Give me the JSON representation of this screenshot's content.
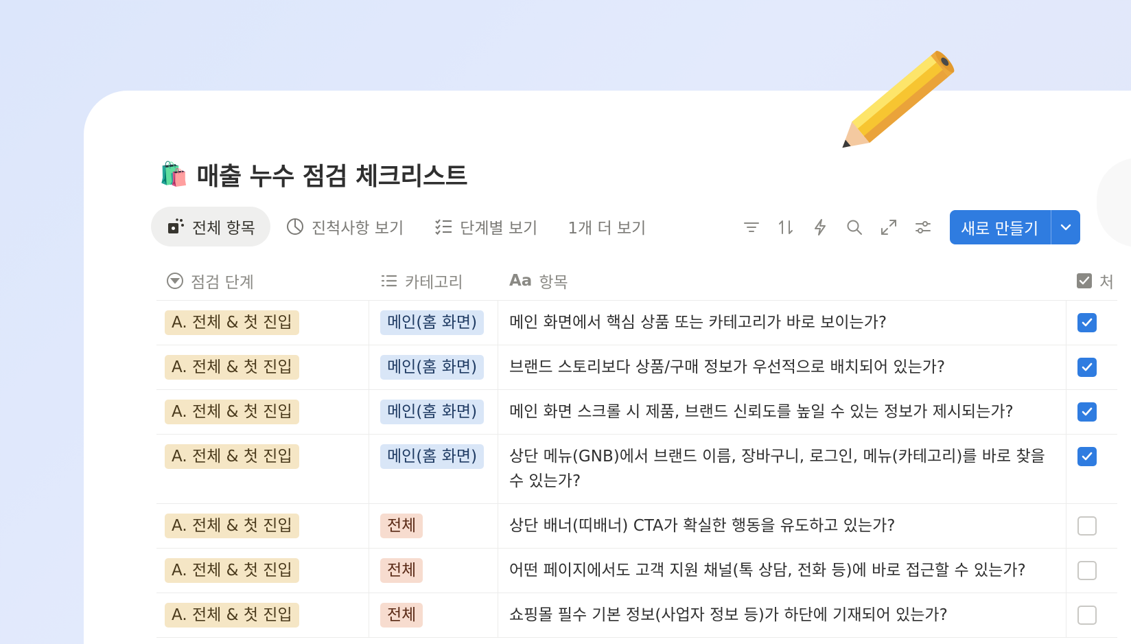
{
  "page": {
    "title": "매출 누수 점검 체크리스트",
    "title_icon": "shopping-bags-icon"
  },
  "views": [
    {
      "label": "전체 항목",
      "icon": "gallery-icon",
      "active": true
    },
    {
      "label": "진척사항 보기",
      "icon": "pie-chart-icon",
      "active": false
    },
    {
      "label": "단계별 보기",
      "icon": "checklist-icon",
      "active": false
    },
    {
      "label": "1개 더 보기",
      "icon": "",
      "active": false
    }
  ],
  "toolbar": {
    "icons": [
      "filter-icon",
      "sort-icon",
      "automation-icon",
      "search-icon",
      "expand-icon",
      "settings-sliders-icon"
    ],
    "new_label": "새로 만들기"
  },
  "columns": {
    "stage": "점검 단계",
    "category": "카테고리",
    "item": "항목",
    "item_icon_text": "Aa",
    "check": "처"
  },
  "rows": [
    {
      "stage": "A. 전체 & 첫 진입",
      "category": "메인(홈 화면)",
      "category_type": "main",
      "item": "메인 화면에서 핵심 상품 또는 카테고리가 바로 보이는가?",
      "checked": true
    },
    {
      "stage": "A. 전체 & 첫 진입",
      "category": "메인(홈 화면)",
      "category_type": "main",
      "item": "브랜드 스토리보다 상품/구매 정보가 우선적으로 배치되어 있는가?",
      "checked": true
    },
    {
      "stage": "A. 전체 & 첫 진입",
      "category": "메인(홈 화면)",
      "category_type": "main",
      "item": "메인 화면 스크롤 시 제품, 브랜드 신뢰도를 높일 수 있는 정보가 제시되는가?",
      "checked": true
    },
    {
      "stage": "A. 전체 & 첫 진입",
      "category": "메인(홈 화면)",
      "category_type": "main",
      "item": "상단 메뉴(GNB)에서 브랜드 이름, 장바구니, 로그인, 메뉴(카테고리)를 바로 찾을 수 있는가?",
      "checked": true
    },
    {
      "stage": "A. 전체 & 첫 진입",
      "category": "전체",
      "category_type": "all",
      "item": "상단 배너(띠배너) CTA가 확실한 행동을 유도하고 있는가?",
      "checked": false
    },
    {
      "stage": "A. 전체 & 첫 진입",
      "category": "전체",
      "category_type": "all",
      "item": "어떤 페이지에서도 고객 지원 채널(톡 상담, 전화 등)에 바로 접근할 수 있는가?",
      "checked": false
    },
    {
      "stage": "A. 전체 & 첫 진입",
      "category": "전체",
      "category_type": "all",
      "item": "쇼핑몰 필수 기본 정보(사업자 정보 등)가 하단에 기재되어 있는가?",
      "checked": false
    }
  ],
  "colors": {
    "accent": "#2f7ce0",
    "stage_tag": "#f5e6c5",
    "category_main_tag": "#d9e6f7",
    "category_all_tag": "#f7dccf"
  }
}
